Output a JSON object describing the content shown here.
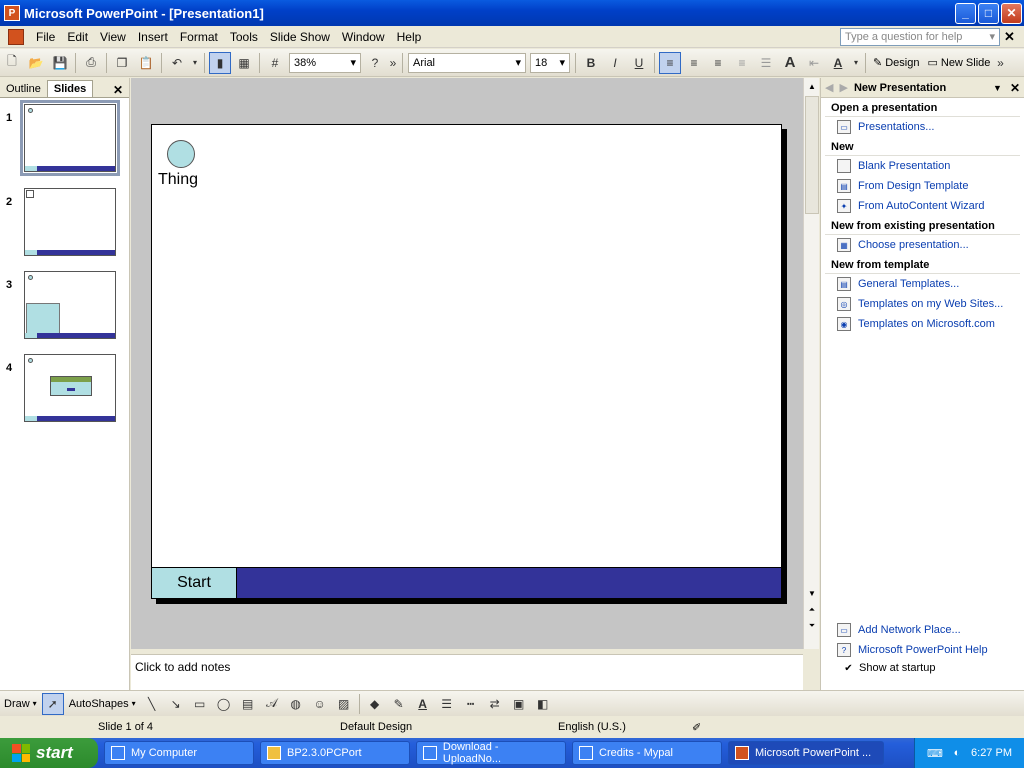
{
  "window": {
    "title": "Microsoft PowerPoint - [Presentation1]",
    "min": "_",
    "max": "□",
    "close": "✕"
  },
  "menu": {
    "items": [
      "File",
      "Edit",
      "View",
      "Insert",
      "Format",
      "Tools",
      "Slide Show",
      "Window",
      "Help"
    ],
    "help_placeholder": "Type a question for help",
    "doc_close": "✕"
  },
  "toolbar": {
    "zoom": "38%",
    "font": "Arial",
    "size": "18",
    "bold": "B",
    "italic": "I",
    "underline": "U",
    "design": "Design",
    "new_slide": "New Slide"
  },
  "left_pane": {
    "tab_outline": "Outline",
    "tab_slides": "Slides",
    "close": "✕",
    "slides": [
      "1",
      "2",
      "3",
      "4"
    ]
  },
  "slide": {
    "thing_label": "Thing",
    "start_label": "Start"
  },
  "notes": {
    "placeholder": "Click to add notes"
  },
  "task_pane": {
    "title": "New Presentation",
    "sections": {
      "open": "Open a presentation",
      "new": "New",
      "existing": "New from existing presentation",
      "template": "New from template"
    },
    "links": {
      "presentations": "Presentations...",
      "blank": "Blank Presentation",
      "design_template": "From Design Template",
      "autocontent": "From AutoContent Wizard",
      "choose": "Choose presentation...",
      "general_templates": "General Templates...",
      "web_templates": "Templates on my Web Sites...",
      "ms_templates": "Templates on Microsoft.com",
      "network_place": "Add Network Place...",
      "ppt_help": "Microsoft PowerPoint Help"
    },
    "show_at_startup": "Show at startup"
  },
  "drawbar": {
    "draw": "Draw",
    "autoshapes": "AutoShapes"
  },
  "status": {
    "slide": "Slide 1 of 4",
    "design": "Default Design",
    "language": "English (U.S.)"
  },
  "taskbar": {
    "start": "start",
    "tasks": [
      "My Computer",
      "BP2.3.0PCPort",
      "Download - UploadNo...",
      "Credits - Mypal",
      "Microsoft PowerPoint ..."
    ],
    "time": "6:27 PM"
  },
  "colors": {
    "slide_accent": "#333399",
    "slide_light": "#b0dfe3"
  }
}
